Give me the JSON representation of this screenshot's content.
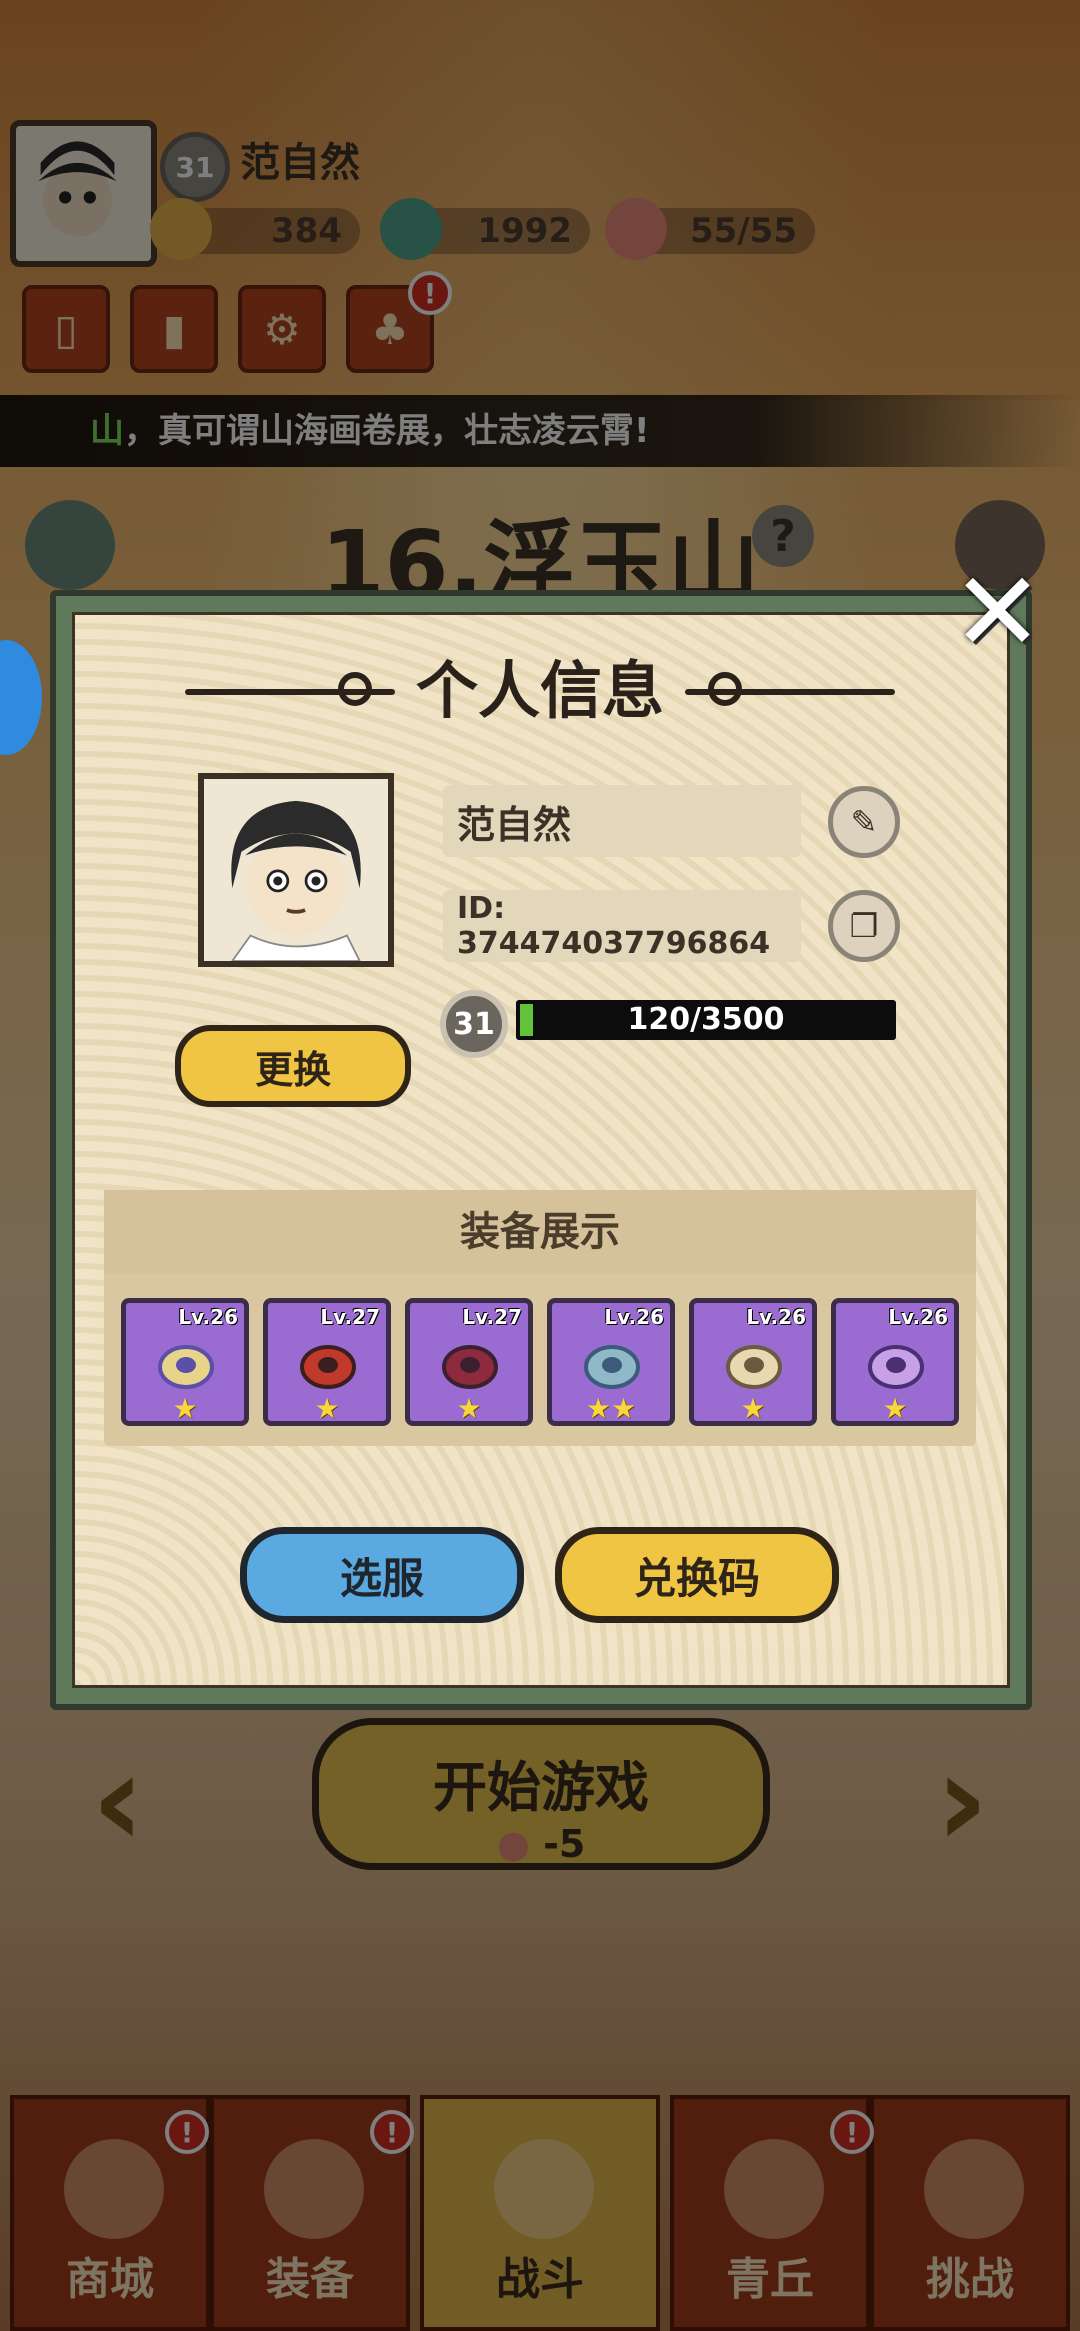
{
  "hud": {
    "player_level": "31",
    "player_name": "范自然",
    "coins": "384",
    "jade": "1992",
    "stamina": "55/55"
  },
  "marquee": {
    "highlight": "山",
    "text": "，真可谓山海画卷展，壮志凌云霄!"
  },
  "stage": {
    "title": "16.浮玉山",
    "help": "?"
  },
  "start": {
    "label": "开始游戏",
    "cost": "-5"
  },
  "nav": {
    "items": [
      {
        "label": "商城"
      },
      {
        "label": "装备"
      },
      {
        "label": "战斗"
      },
      {
        "label": "青丘"
      },
      {
        "label": "挑战"
      }
    ]
  },
  "modal": {
    "title": "个人信息",
    "name": "范自然",
    "id": "ID: 374474037796864",
    "level": "31",
    "xp_text": "120/3500",
    "xp_fraction": 0.034,
    "change_label": "更换",
    "equipment_title": "装备展示",
    "equipment": [
      {
        "level": "Lv.26",
        "stars": "★"
      },
      {
        "level": "Lv.27",
        "stars": "★"
      },
      {
        "level": "Lv.27",
        "stars": "★"
      },
      {
        "level": "Lv.26",
        "stars": "★★"
      },
      {
        "level": "Lv.26",
        "stars": "★"
      },
      {
        "level": "Lv.26",
        "stars": "★"
      }
    ],
    "server_label": "选服",
    "redeem_label": "兑换码",
    "close": "✕"
  },
  "icons": {
    "alert": "!",
    "edit": "✎",
    "copy": "❐"
  },
  "colors": {
    "xp_fill": "#62c23a",
    "equip_purple": "#9a6bd0",
    "button_yellow": "#f0c543",
    "button_blue": "#5aa9e0"
  }
}
